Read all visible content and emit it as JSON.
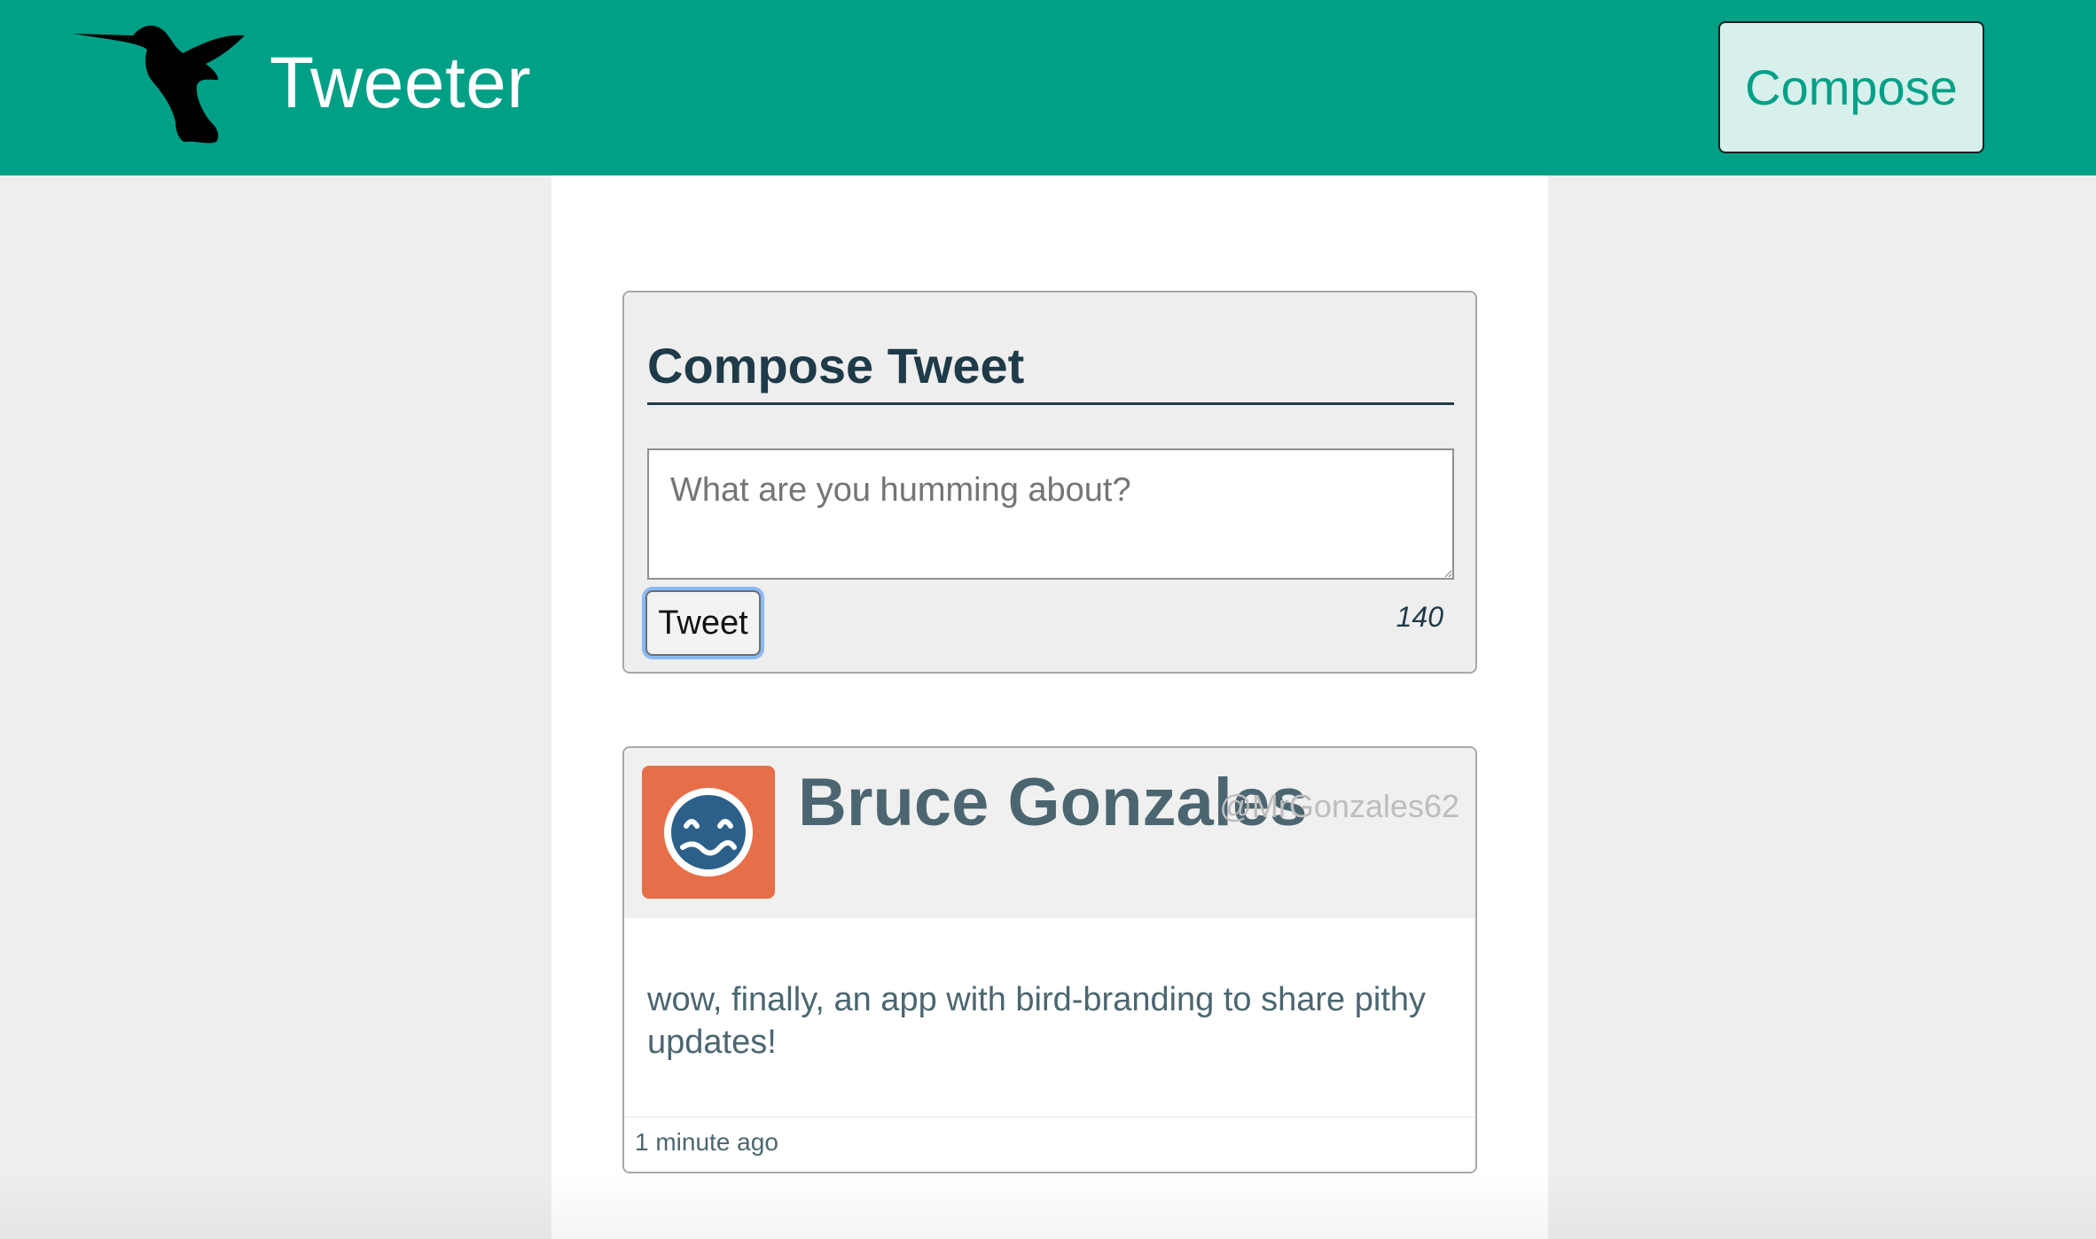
{
  "theme": {
    "brand_color": "#00a087",
    "avatar_bg": "#e66f4a"
  },
  "header": {
    "logo_icon": "hummingbird-logo",
    "title": "Tweeter",
    "compose_button": "Compose"
  },
  "compose": {
    "heading": "Compose Tweet",
    "textarea_placeholder": "What are you humming about?",
    "textarea_value": "",
    "submit_label": "Tweet",
    "char_counter": "140"
  },
  "tweets": [
    {
      "avatar_icon": "smiley-face-avatar",
      "name": "Bruce Gonzales",
      "handle": "@MrGonzales62",
      "content": "wow, finally, an app with bird-branding to share pithy updates!",
      "timestamp": "1 minute ago"
    }
  ]
}
